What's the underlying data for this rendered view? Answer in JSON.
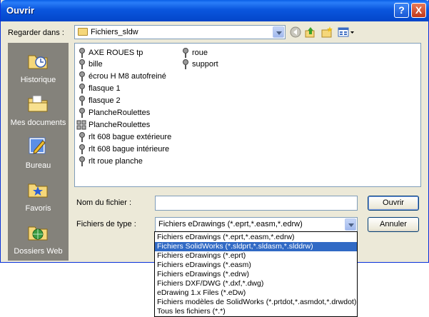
{
  "window": {
    "title": "Ouvrir",
    "help_label": "?",
    "close_label": "X"
  },
  "toolbar": {
    "look_in_label": "Regarder dans :",
    "look_in_value": "Fichiers_sldw",
    "back_icon": "back-arrow-icon",
    "up_icon": "up-folder-icon",
    "new_folder_icon": "new-folder-icon",
    "views_icon": "views-menu-icon"
  },
  "places": [
    {
      "label": "Historique",
      "icon": "history-icon"
    },
    {
      "label": "Mes documents",
      "icon": "my-documents-icon"
    },
    {
      "label": "Bureau",
      "icon": "desktop-icon"
    },
    {
      "label": "Favoris",
      "icon": "favorites-icon"
    },
    {
      "label": "Dossiers Web",
      "icon": "web-folders-icon"
    }
  ],
  "files": [
    {
      "name": "AXE ROUES tp",
      "icon": "part-icon"
    },
    {
      "name": "bille",
      "icon": "part-icon"
    },
    {
      "name": "écrou H M8 autofreiné",
      "icon": "part-icon"
    },
    {
      "name": "flasque 1",
      "icon": "part-icon"
    },
    {
      "name": "flasque 2",
      "icon": "part-icon"
    },
    {
      "name": "PlancheRoulettes",
      "icon": "part-icon"
    },
    {
      "name": "PlancheRoulettes",
      "icon": "assembly-icon"
    },
    {
      "name": "rlt 608 bague extérieure",
      "icon": "part-icon"
    },
    {
      "name": "rlt 608 bague intérieure",
      "icon": "part-icon"
    },
    {
      "name": "rlt roue planche",
      "icon": "part-icon"
    },
    {
      "name": "roue",
      "icon": "part-icon"
    },
    {
      "name": "support",
      "icon": "part-icon"
    }
  ],
  "filename": {
    "label": "Nom du fichier :",
    "value": ""
  },
  "filetype": {
    "label": "Fichiers de type :",
    "value": "Fichiers eDrawings (*.eprt,*.easm,*.edrw)",
    "options": [
      "Fichiers eDrawings (*.eprt,*.easm,*.edrw)",
      "Fichiers SolidWorks (*.sldprt,*.sldasm,*.slddrw)",
      "Fichiers eDrawings (*.eprt)",
      "Fichiers eDrawings (*.easm)",
      "Fichiers eDrawings (*.edrw)",
      "Fichiers DXF/DWG (*.dxf,*.dwg)",
      "eDrawing 1.x Files (*.eDw)",
      "Fichiers modèles de SolidWorks (*.prtdot,*.asmdot,*.drwdot)",
      "Tous les fichiers (*.*)"
    ],
    "selected_index": 1
  },
  "buttons": {
    "open": "Ouvrir",
    "cancel": "Annuler"
  },
  "colors": {
    "title_bar": "#0a56de",
    "selection": "#316ac5",
    "places_bar": "#84827b"
  }
}
